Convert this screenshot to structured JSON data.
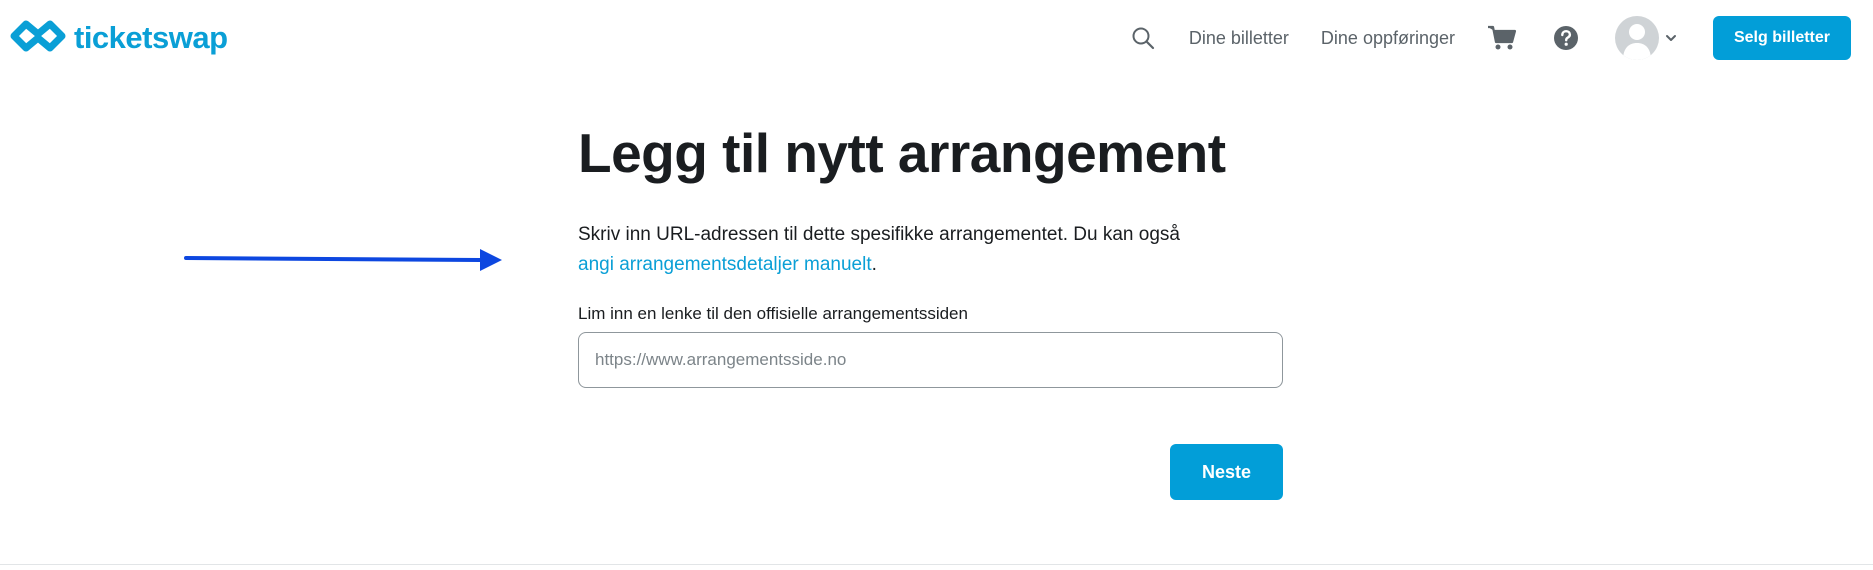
{
  "header": {
    "logo_text": "ticketswap",
    "logo_icon": "ticketswap-logo-icon",
    "search_icon": "search-icon",
    "nav_links": [
      {
        "label": "Dine billetter"
      },
      {
        "label": "Dine oppføringer"
      }
    ],
    "cart_icon": "cart-icon",
    "help_icon": "help-icon",
    "avatar_icon": "user-avatar-icon",
    "sell_button_label": "Selg billetter"
  },
  "main": {
    "title": "Legg til nytt arrangement",
    "intro_text": "Skriv inn URL-adressen til dette spesifikke arrangementet. Du kan også",
    "manual_link_text": "angi arrangementsdetaljer manuelt",
    "intro_suffix": ".",
    "field_label": "Lim inn en lenke til den offisielle arrangementssiden",
    "url_input": {
      "value": "",
      "placeholder": "https://www.arrangementsside.no"
    },
    "next_button_label": "Neste"
  },
  "colors": {
    "brand": "#029ed8",
    "annotation_arrow": "#0d47e0",
    "text": "#1a1d20",
    "muted": "#5b6369"
  }
}
